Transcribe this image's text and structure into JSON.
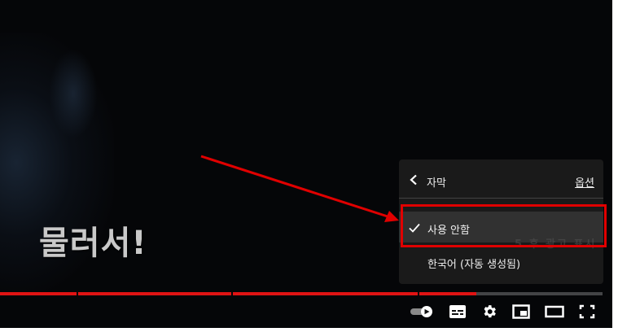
{
  "video": {
    "subtitle_text": "물러서!",
    "progress_fraction": 0.79
  },
  "settings_menu": {
    "title": "자막",
    "options_link": "옵션",
    "items": [
      {
        "label": "사용 안함",
        "selected": true
      },
      {
        "label": "한국어 (자동 생성됨)",
        "selected": false
      }
    ],
    "ghost_text": "5 후 광고 표시"
  },
  "controls": [
    {
      "name": "autoplay-toggle-icon"
    },
    {
      "name": "subtitles-icon"
    },
    {
      "name": "settings-gear-icon"
    },
    {
      "name": "miniplayer-icon"
    },
    {
      "name": "theater-mode-icon"
    },
    {
      "name": "fullscreen-icon"
    }
  ],
  "colors": {
    "progress": "#e01313",
    "annotation": "#e00000",
    "menu_bg": "#1c1c1c"
  }
}
